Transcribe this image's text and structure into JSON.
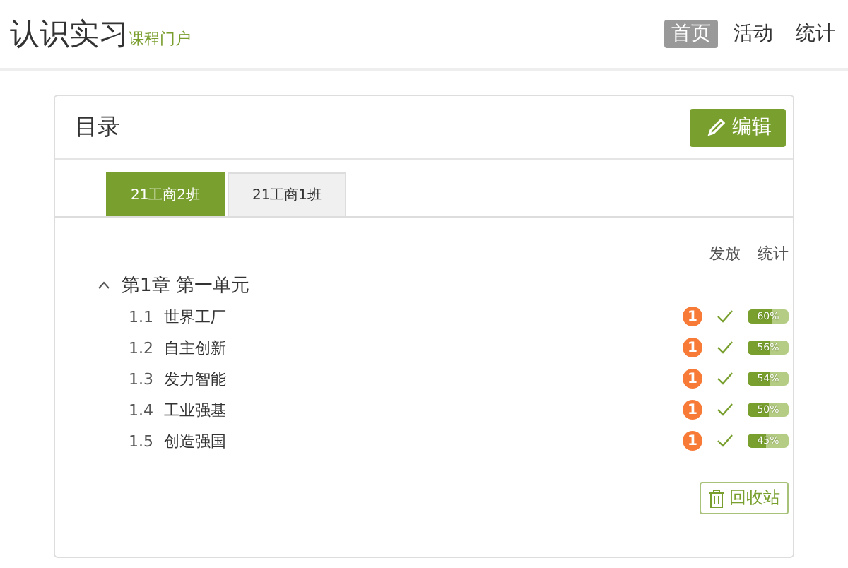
{
  "header": {
    "title": "认识实习",
    "subtitle": "课程门户",
    "nav": [
      {
        "label": "首页",
        "selected": true
      },
      {
        "label": "活动",
        "selected": false
      },
      {
        "label": "统计",
        "selected": false
      }
    ]
  },
  "card": {
    "title": "目录",
    "edit_button": "编辑",
    "tabs": [
      {
        "label": "21工商2班",
        "selected": true
      },
      {
        "label": "21工商1班",
        "selected": false
      }
    ],
    "columns": [
      "发放",
      "统计"
    ],
    "chapters": [
      {
        "title": "第1章 第一单元",
        "expanded": true,
        "children": [
          {
            "number": "1.1",
            "title": "世界工厂",
            "badge": "1",
            "published": true,
            "level": 0.6,
            "reading": "60%"
          },
          {
            "number": "1.2",
            "title": "自主创新",
            "badge": "1",
            "published": true,
            "level": 0.56,
            "reading": "56%"
          },
          {
            "number": "1.3",
            "title": "发力智能",
            "badge": "1",
            "published": true,
            "level": 0.54,
            "reading": "54%"
          },
          {
            "number": "1.4",
            "title": "工业强基",
            "badge": "1",
            "published": true,
            "level": 0.5,
            "reading": "50%"
          },
          {
            "number": "1.5",
            "title": "创造强国",
            "badge": "1",
            "published": true,
            "level": 0.45,
            "reading": "45%"
          }
        ]
      }
    ],
    "recycle_button": "回收站"
  }
}
